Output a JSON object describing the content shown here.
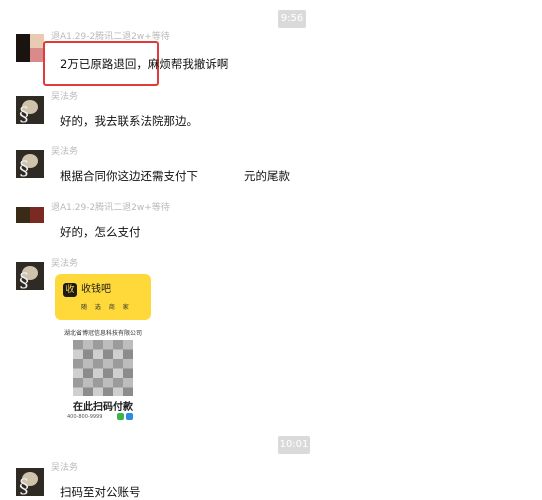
{
  "timestamps": [
    "9:56",
    "10:01"
  ],
  "senders": {
    "customer": "退A1.29-2腾讯二退2w+等待",
    "lawyer": "吴法务"
  },
  "messages": {
    "m1": "2万已原路退回，麻烦帮我撤诉啊",
    "m2": "好的，我去联系法院那边。",
    "m3_before": "根据合同你这边还需支付下",
    "m3_after": "元的尾款",
    "m4": "好的，怎么支付",
    "m6": "扫码至对公账号"
  },
  "pay_card": {
    "logo_glyph": "收",
    "brand": "收钱吧",
    "slogan": "随 选 商 家",
    "company": "湖北省博冠信息科技有限公司",
    "pay_text": "在此扫码付款",
    "phone": "400-800-9999"
  },
  "colors": {
    "highlight_border": "#e23a3a",
    "card_yellow": "#ffd93a",
    "timestamp_bg": "#dadada"
  }
}
